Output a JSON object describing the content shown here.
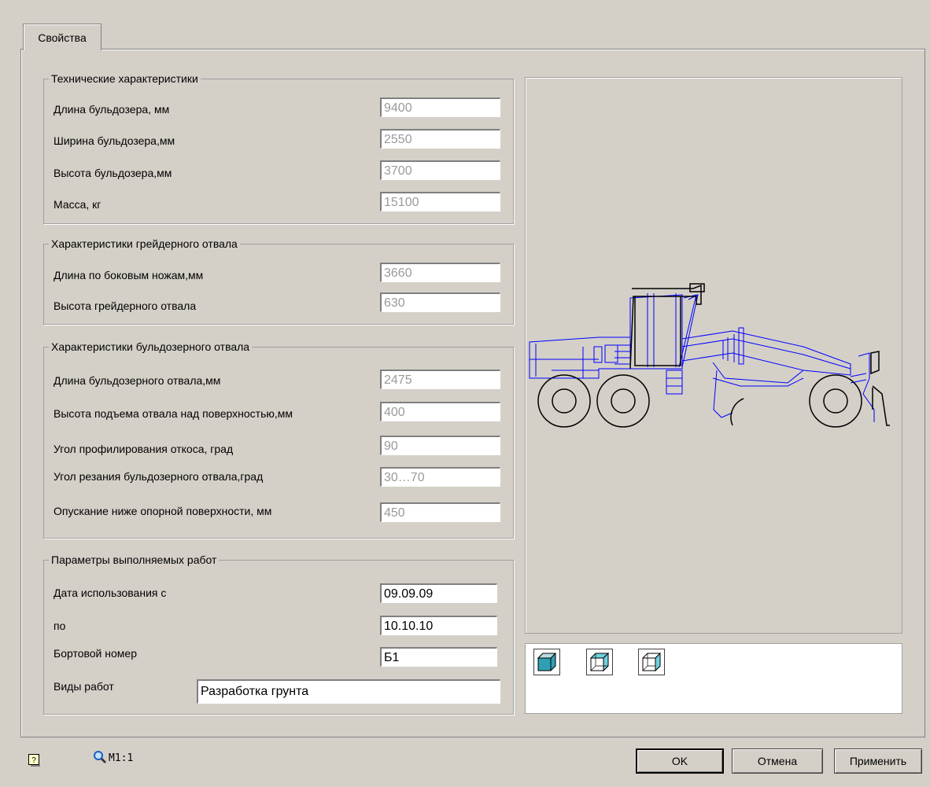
{
  "tab": {
    "label": "Свойства"
  },
  "tech": {
    "legend": "Технические характеристики",
    "rows": [
      {
        "label": "Длина бульдозера, мм",
        "value": "9400"
      },
      {
        "label": "Ширина бульдозера,мм",
        "value": "2550"
      },
      {
        "label": "Высота бульдозера,мм",
        "value": "3700"
      },
      {
        "label": "Масса, кг",
        "value": "15100"
      }
    ]
  },
  "grader": {
    "legend": "Характеристики грейдерного отвала",
    "rows": [
      {
        "label": "Длина по боковым ножам,мм",
        "value": "3660"
      },
      {
        "label": "Высота грейдерного отвала",
        "value": "630"
      }
    ]
  },
  "dozer": {
    "legend": "Характеристики бульдозерного отвала",
    "rows": [
      {
        "label": "Длина бульдозерного отвала,мм",
        "value": "2475"
      },
      {
        "label": "Высота подъема отвала над поверхностью,мм",
        "value": "400"
      },
      {
        "label": "Угол профилирования откоса, град",
        "value": "90"
      },
      {
        "label": "Угол резания бульдозерного отвала,град",
        "value": "30…70"
      },
      {
        "label": "Опускание ниже опорной поверхности, мм",
        "value": "450"
      }
    ]
  },
  "work": {
    "legend": "Параметры выполняемых работ",
    "date_from_label": "Дата использования с",
    "date_from": "09.09.09",
    "date_to_label": "по",
    "date_to": "10.10.10",
    "board_label": "Бортовой номер",
    "board": "Б1",
    "kinds_label": "Виды работ",
    "kinds": "Разработка грунта"
  },
  "view_buttons": [
    "solid-cube-icon",
    "shaded-wire-cube-icon",
    "wire-cube-icon"
  ],
  "footer": {
    "help_icon": "help-icon",
    "zoom_icon": "magnifier-icon",
    "scale": "M1:1",
    "ok": "OK",
    "cancel": "Отмена",
    "apply": "Применить"
  },
  "colors": {
    "drawing_blue": "#0000ff",
    "cube_teal": "#2fa0b4"
  }
}
